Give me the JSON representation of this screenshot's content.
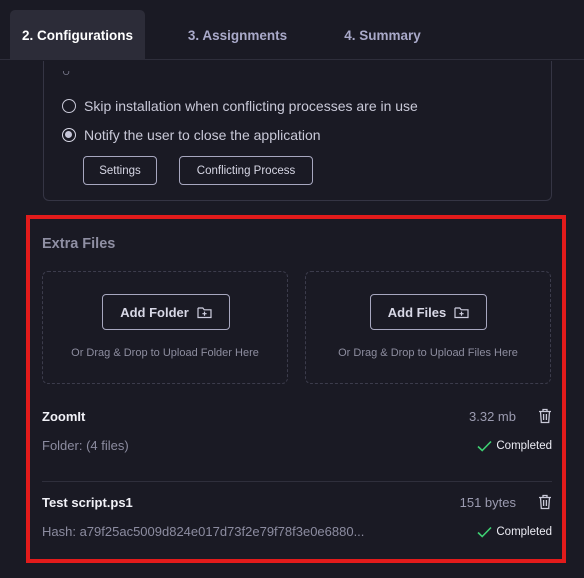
{
  "tabs": [
    {
      "label": "2. Configurations",
      "active": true
    },
    {
      "label": "3. Assignments",
      "active": false
    },
    {
      "label": "4. Summary",
      "active": false
    }
  ],
  "options": {
    "radio_options": [
      {
        "label": "Skip installation when conflicting processes are in use",
        "checked": false
      },
      {
        "label": "Notify the user to close the application",
        "checked": true
      }
    ],
    "settings_label": "Settings",
    "conflicting_process_label": "Conflicting Process"
  },
  "extra_files": {
    "title": "Extra Files",
    "add_folder": {
      "label": "Add Folder",
      "hint": "Or Drag & Drop to Upload Folder Here"
    },
    "add_files": {
      "label": "Add Files",
      "hint": "Or Drag & Drop to Upload Files Here"
    },
    "items": [
      {
        "name": "ZoomIt",
        "size": "3.32 mb",
        "meta": "Folder: (4 files)",
        "status": "Completed"
      },
      {
        "name": "Test script.ps1",
        "size": "151 bytes",
        "meta": "Hash: a79f25ac5009d824e017d73f2e79f78f3e0e6880...",
        "status": "Completed"
      }
    ]
  },
  "colors": {
    "highlight": "#e21b1b",
    "success": "#3ecf72",
    "background": "#1a1a24"
  },
  "icons": {
    "add_folder": "folder-plus-icon",
    "add_files": "file-plus-icon",
    "delete": "trash-icon",
    "status": "check-icon"
  }
}
